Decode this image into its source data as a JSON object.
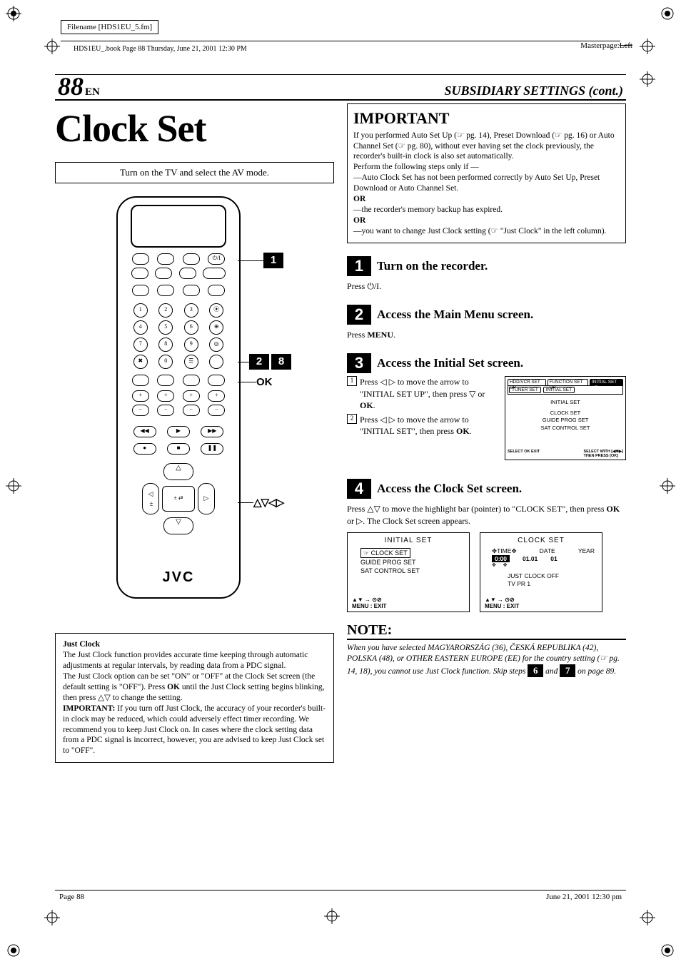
{
  "meta": {
    "filename_label": "Filename [HDS1EU_5.fm]",
    "book_info": "HDS1EU_.book  Page 88  Thursday, June 21, 2001  12:30 PM",
    "masterpage_label": "Masterpage:",
    "masterpage_value": "Left"
  },
  "header": {
    "page_number": "88",
    "lang": "EN",
    "section_title": "SUBSIDIARY SETTINGS (cont.)"
  },
  "left": {
    "title": "Clock Set",
    "intro": "Turn on the TV and select the AV mode.",
    "remote_brand": "JVC",
    "callout_ok": "OK",
    "arrow_symbols": "△▽◁▷",
    "just_clock": {
      "title": "Just Clock",
      "p1": "The Just Clock function provides accurate time keeping through automatic adjustments at regular intervals, by reading data from a PDC signal.",
      "p2_a": "The Just Clock option can be set \"ON\" or \"OFF\" at the Clock Set screen (the default setting is \"OFF\"). Press ",
      "p2_ok": "OK",
      "p2_b": " until the Just Clock setting begins blinking, then press △▽ to change the setting.",
      "p3_label": "IMPORTANT:",
      "p3": " If you turn off Just Clock, the accuracy of your recorder's built-in clock may be reduced, which could adversely effect timer recording. We recommend you to keep Just Clock on. In cases where the clock setting data from a PDC signal is incorrect, however, you are advised to keep Just Clock set to \"OFF\"."
    }
  },
  "right": {
    "important": {
      "title": "IMPORTANT",
      "p1": "If you performed Auto Set Up (☞ pg. 14), Preset Download (☞ pg. 16) or Auto Channel Set (☞ pg. 80), without ever having set the clock previously, the recorder's built-in clock is also set automatically.",
      "p2": "Perform the following steps only if —",
      "p3": "—Auto Clock Set has not been performed correctly by Auto Set Up, Preset Download or Auto Channel Set.",
      "or": "OR",
      "p4": "—the recorder's memory backup has expired.",
      "p5": "—you want to change Just Clock setting (☞ \"Just Clock\" in the left column)."
    },
    "steps": {
      "s1": {
        "num": "1",
        "title": "Turn on the recorder.",
        "body": "Press ⏻/I."
      },
      "s2": {
        "num": "2",
        "title": "Access the Main Menu screen.",
        "body_a": "Press ",
        "body_b": "MENU",
        "body_c": "."
      },
      "s3": {
        "num": "3",
        "title": "Access the Initial Set screen.",
        "sub1_idx": "1",
        "sub1_a": "Press ◁ ▷ to move the arrow to \"INITIAL SET UP\", then press ▽ or ",
        "sub1_ok": "OK",
        "sub1_b": ".",
        "sub2_idx": "2",
        "sub2_a": "Press ◁ ▷ to move the arrow to \"INITIAL SET\", then press ",
        "sub2_ok": "OK",
        "sub2_b": ".",
        "osd": {
          "tabs": [
            "HDD/VCR SET UP",
            "FUNCTION SET UP",
            "INITIAL SET UP"
          ],
          "subtabs": [
            "TUNER SET",
            "INITIAL SET"
          ],
          "heading": "INITIAL SET",
          "items": [
            "CLOCK SET",
            "GUIDE PROG SET",
            "SAT CONTROL SET"
          ],
          "foot_left": "SELECT  OK  EXIT",
          "foot_right": "SELECT WITH [◀✥▶]\nTHEN PRESS [OK]"
        }
      },
      "s4": {
        "num": "4",
        "title": "Access the Clock Set screen.",
        "body_a": "Press △▽ to move the highlight bar (pointer) to \"CLOCK SET\", then press ",
        "body_ok": "OK",
        "body_b": " or ▷. The Clock Set screen appears.",
        "osd_left": {
          "title": "INITIAL SET",
          "item_sel": "☞ CLOCK SET",
          "items": [
            "GUIDE PROG SET",
            "SAT CONTROL SET"
          ],
          "foot": "▲▼ → ⊙⊘\nMENU : EXIT"
        },
        "osd_right": {
          "title": "CLOCK SET",
          "labels": [
            "TIME",
            "DATE",
            "YEAR"
          ],
          "values": [
            "0:00",
            "01.01",
            "01"
          ],
          "jc_lines": [
            "JUST CLOCK  OFF",
            "TV PR         1"
          ],
          "foot": "▲▼ → ⊙⊘\nMENU : EXIT"
        }
      }
    },
    "note": {
      "title": "NOTE:",
      "body_a": "When you have selected MAGYARORSZÁG (36), ČESKÁ REPUBLIKA (42), POLSKA (48), or OTHER EASTERN EUROPE (EE) for the country setting (☞ pg. 14, 18), you cannot use Just Clock function. Skip steps ",
      "box1": "6",
      "and": " and ",
      "box2": "7",
      "body_b": " on page 89."
    }
  },
  "footer": {
    "left": "Page 88",
    "right": "June 21, 2001  12:30 pm"
  }
}
